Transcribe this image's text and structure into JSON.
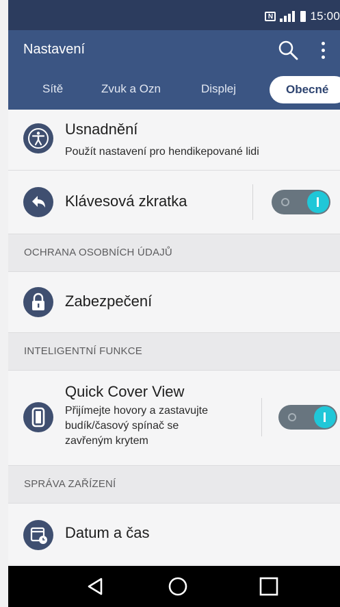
{
  "status_bar": {
    "time": "15:00",
    "icons": [
      "nfc-icon",
      "signal-icon",
      "battery-icon"
    ]
  },
  "app_bar": {
    "title": "Nastavení",
    "icons": [
      "search-icon",
      "more-vert-icon"
    ]
  },
  "tabs": [
    {
      "label": "Sítě",
      "active": false
    },
    {
      "label": "Zvuk a Ozn",
      "active": false
    },
    {
      "label": "Displej",
      "active": false
    },
    {
      "label": "Obecné",
      "active": true
    }
  ],
  "items": {
    "accessibility": {
      "title": "Usnadnění",
      "subtitle": "Použít nastavení pro hendikepované lidi",
      "icon": "accessibility-icon"
    },
    "shortcut_key": {
      "title": "Klávesová zkratka",
      "icon": "back-arrow-icon",
      "enabled": true
    },
    "section_privacy": "OCHRANA OSOBNÍCH ÚDAJŮ",
    "security": {
      "title": "Zabezpečení",
      "icon": "lock-icon"
    },
    "section_smart": "INTELIGENTNÍ FUNKCE",
    "quick_cover": {
      "title": "Quick Cover View",
      "subtitle_lines": [
        "Přijímejte hovory a zastavujte",
        "budík/časový spínač se",
        "zavřeným krytem"
      ],
      "icon": "cover-icon",
      "enabled": true
    },
    "section_device": "SPRÁVA ZAŘÍZENÍ",
    "date_time": {
      "title": "Datum a čas",
      "icon": "calendar-clock-icon"
    }
  },
  "nav_bar": {
    "icons": [
      "back-icon",
      "home-icon",
      "recents-icon"
    ]
  },
  "colors": {
    "app_bar": "#3b5583",
    "status_bar": "#2c3c5e",
    "toggle_on": "#20c7d8",
    "icon": "#3f4f70"
  }
}
